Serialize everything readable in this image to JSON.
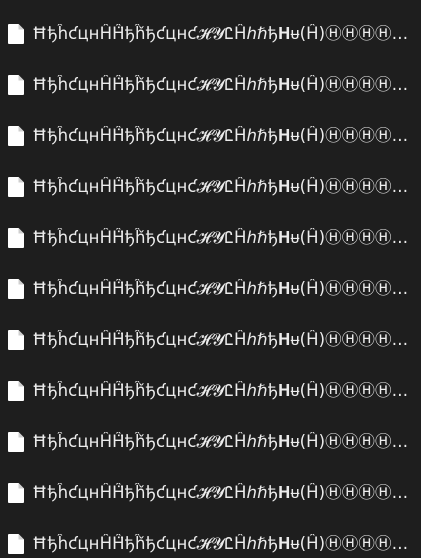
{
  "files": [
    {
      "name": "ĦђĥƈцнĤĤ̈ђĥ̌ђƈцнƈ𝓗𝓨ᏝĤℎℏђ𝐇ᵾ(Ĥ)ⒽⒽⒽⒽнĦĦ̈НЧнĦ̈ĦНЧн",
      "icon": "document-icon"
    },
    {
      "name": "ĦђĥƈцнĤĤ̈ђĥ̌ђƈцнƈ𝓗𝓨ᏝĤℎℏђ𝐇ᵾ(Ĥ)ⒽⒽⒽⒽнĦĦ̈НЧнĦ̈ĦНЧн",
      "icon": "document-icon"
    },
    {
      "name": "ĦђĥƈцнĤĤ̈ђĥ̌ђƈцнƈ𝓗𝓨ᏝĤℎℏђ𝐇ᵾ(Ĥ)ⒽⒽⒽⒽнĦĦ̈НЧнĦ̈ĦНЧн",
      "icon": "document-icon"
    },
    {
      "name": "ĦђĥƈцнĤĤ̈ђĥ̌ђƈцнƈ𝓗𝓨ᏝĤℎℏђ𝐇ᵾ(Ĥ)ⒽⒽⒽⒽнĦĦ̈НЧнĦ̈ĦНЧн",
      "icon": "document-icon"
    },
    {
      "name": "ĦђĥƈцнĤĤ̈ђĥ̌ђƈцнƈ𝓗𝓨ᏝĤℎℏђ𝐇ᵾ(Ĥ)ⒽⒽⒽⒽнĦĦ̈НЧнĦ̈ĦНЧн",
      "icon": "document-icon"
    },
    {
      "name": "ĦђĥƈцнĤĤ̈ђĥ̌ђƈцнƈ𝓗𝓨ᏝĤℎℏђ𝐇ᵾ(Ĥ)ⒽⒽⒽⒽнĦĦ̈НЧнĦ̈ĦНЧн",
      "icon": "document-icon"
    },
    {
      "name": "ĦђĥƈцнĤĤ̈ђĥ̌ђƈцнƈ𝓗𝓨ᏝĤℎℏђ𝐇ᵾ(Ĥ)ⒽⒽⒽⒽнĦĦ̈НЧнĦ̈ĦНЧн",
      "icon": "document-icon"
    },
    {
      "name": "ĦђĥƈцнĤĤ̈ђĥ̌ђƈцнƈ𝓗𝓨ᏝĤℎℏђ𝐇ᵾ(Ĥ)ⒽⒽⒽⒽнĦĦ̈НЧнĦ̈ĦНЧн",
      "icon": "document-icon"
    },
    {
      "name": "ĦђĥƈцнĤĤ̈ђĥ̌ђƈцнƈ𝓗𝓨ᏝĤℎℏђ𝐇ᵾ(Ĥ)ⒽⒽⒽⒽнĦĦ̈НЧнĦ̈ĦНЧн",
      "icon": "document-icon"
    },
    {
      "name": "ĦђĥƈцнĤĤ̈ђĥ̌ђƈцнƈ𝓗𝓨ᏝĤℎℏђ𝐇ᵾ(Ĥ)ⒽⒽⒽⒽнĦĦ̈НЧнĦ̈ĦНЧн",
      "icon": "document-icon"
    },
    {
      "name": "ĦђĥƈцнĤĤ̈ђĥ̌ђƈцнƈ𝓗𝓨ᏝĤℎℏђ𝐇ᵾ(Ĥ)ⒽⒽⒽⒽнĦĦ̈НЧнĦ̈ĦНЧн",
      "icon": "document-icon"
    }
  ],
  "colors": {
    "background": "#1e1e1e",
    "text": "#ececec",
    "icon_fill": "#ffffff"
  }
}
